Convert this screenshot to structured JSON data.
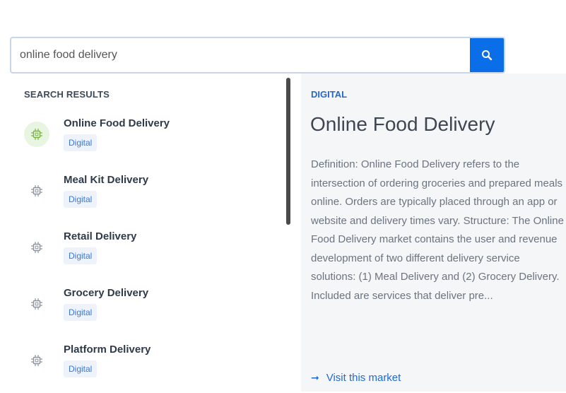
{
  "search": {
    "value": "online food delivery",
    "icon": "search-icon"
  },
  "results": {
    "heading": "SEARCH RESULTS",
    "items": [
      {
        "title": "Online Food Delivery",
        "badge": "Digital",
        "active": true
      },
      {
        "title": "Meal Kit Delivery",
        "badge": "Digital",
        "active": false
      },
      {
        "title": "Retail Delivery",
        "badge": "Digital",
        "active": false
      },
      {
        "title": "Grocery Delivery",
        "badge": "Digital",
        "active": false
      },
      {
        "title": "Platform Delivery",
        "badge": "Digital",
        "active": false
      }
    ]
  },
  "detail": {
    "category": "DIGITAL",
    "title": "Online Food Delivery",
    "description": "Definition: Online Food Delivery refers to the intersection of ordering groceries and prepared meals online. Orders are typically placed through an app or website and delivery times vary. Structure: The Online Food Delivery market contains the user and revenue development of two different delivery service solutions: (1) Meal Delivery and (2) Grocery Delivery. Included are services that deliver pre...",
    "link_label": "Visit this market"
  },
  "colors": {
    "accent": "#0a6ee8",
    "category": "#2a66c8",
    "active_icon_bg": "#e8f5e1",
    "active_icon": "#7cb342",
    "inactive_icon": "#8a949f"
  }
}
